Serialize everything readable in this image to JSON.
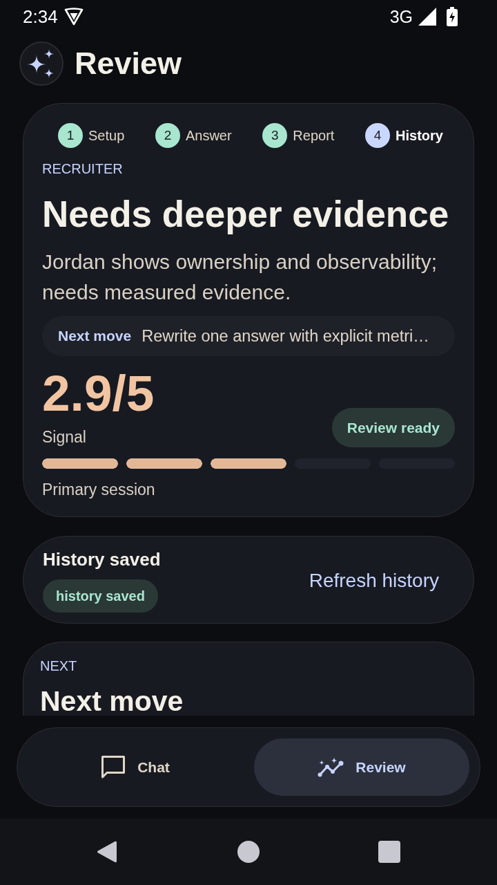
{
  "status_bar": {
    "time": "2:34",
    "network": "3G"
  },
  "header": {
    "title": "Review"
  },
  "review_card": {
    "steps": [
      {
        "number": "1",
        "label": "Setup",
        "selected": false
      },
      {
        "number": "2",
        "label": "Answer",
        "selected": false
      },
      {
        "number": "3",
        "label": "Report",
        "selected": false
      },
      {
        "number": "4",
        "label": "History",
        "selected": true
      }
    ],
    "eyebrow": "RECRUITER",
    "headline": "Needs deeper evidence",
    "summary": "Jordan shows ownership and observability; needs measured evidence.",
    "next_move": {
      "label": "Next move",
      "text": "Rewrite one answer with explicit metri…"
    },
    "score": {
      "value": "2.9/5",
      "label": "Signal",
      "level": 0.6,
      "caption": "Primary session"
    },
    "status_badge": "Review ready"
  },
  "history_card": {
    "title": "History saved",
    "badge": "history saved",
    "button": "Refresh history"
  },
  "next_card": {
    "eyebrow": "NEXT",
    "title": "Next move"
  },
  "bottom_nav": [
    {
      "label": "Chat",
      "kind": "chat",
      "selected": false
    },
    {
      "label": "Review",
      "kind": "review",
      "selected": true
    }
  ]
}
